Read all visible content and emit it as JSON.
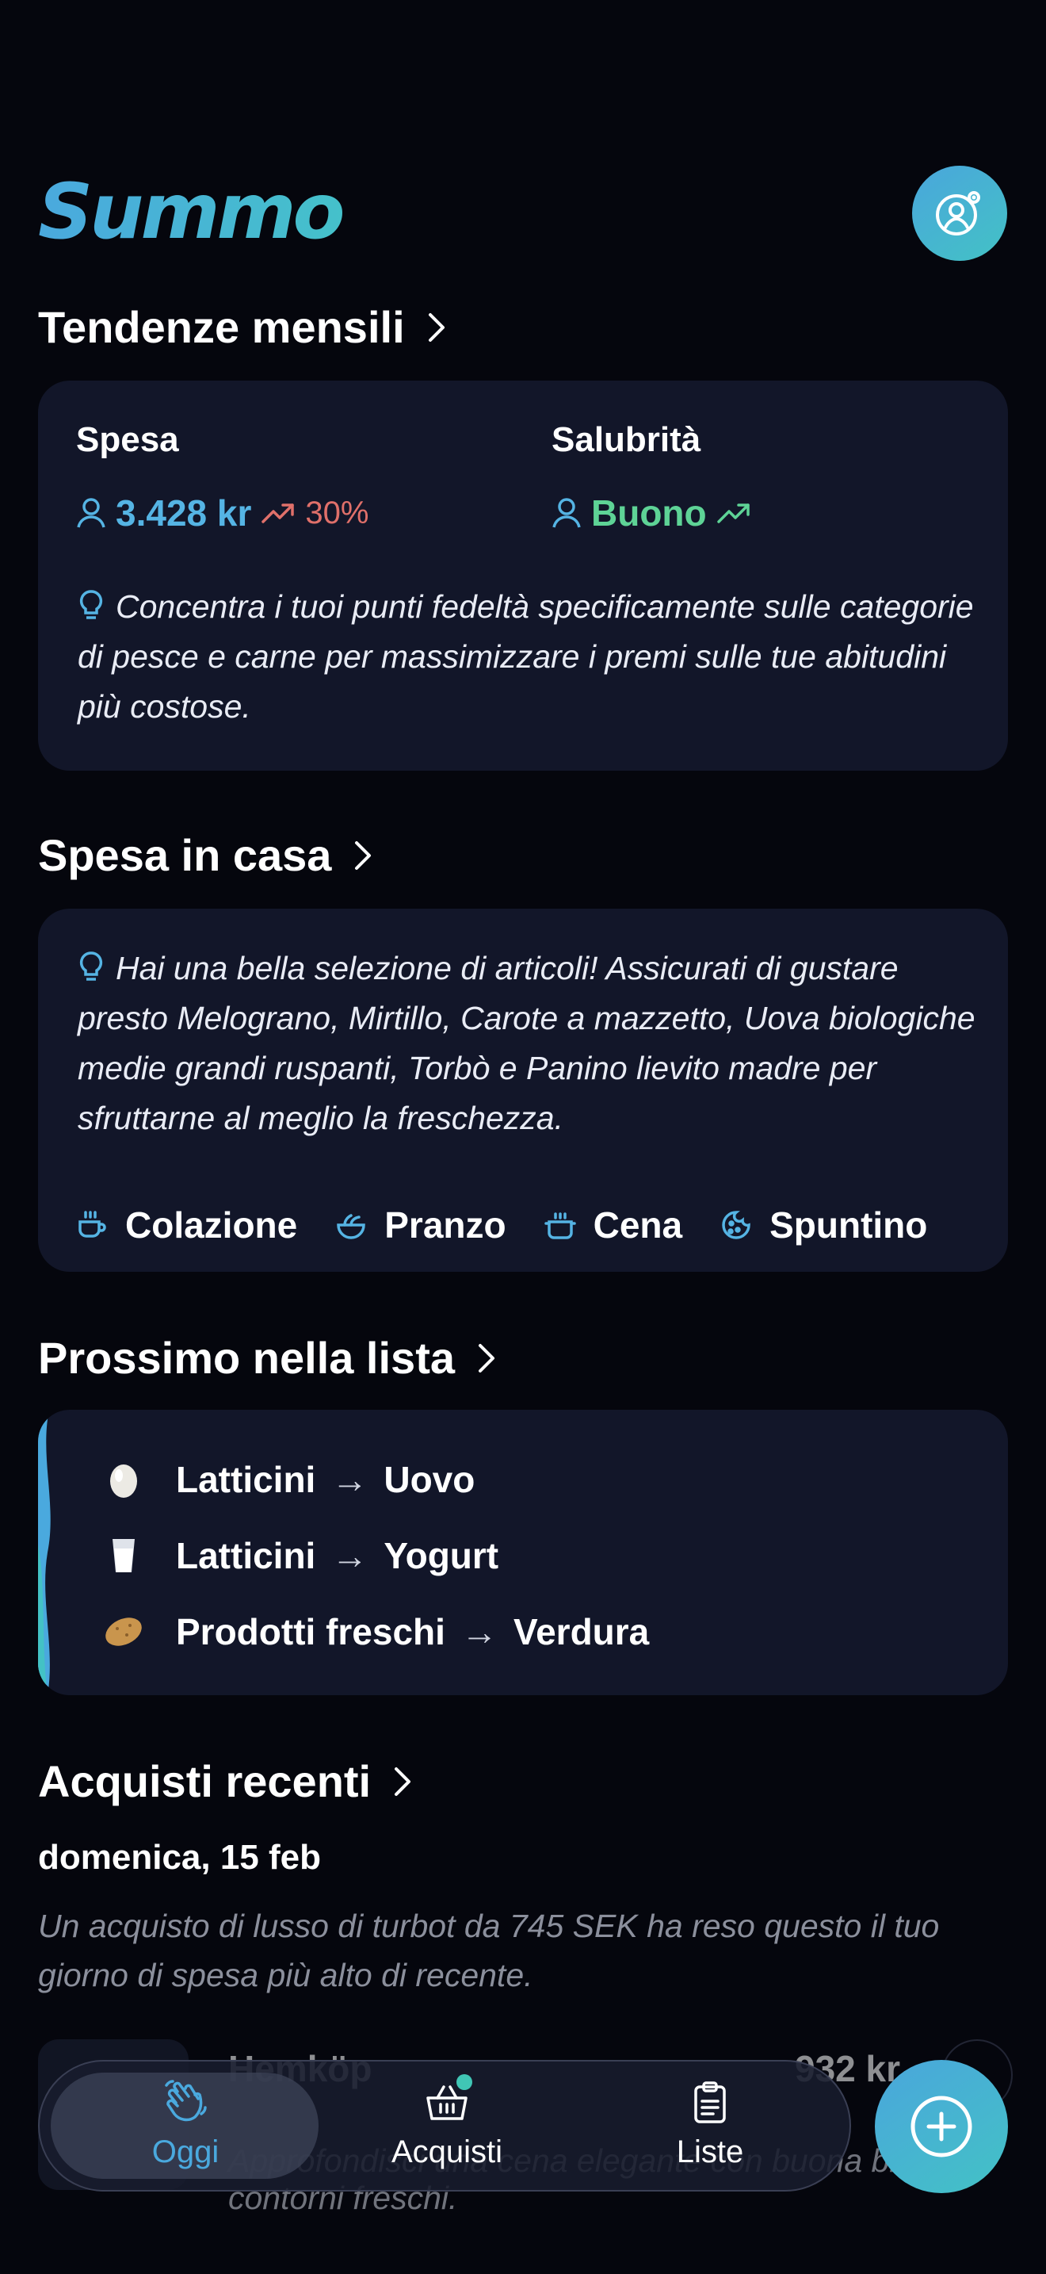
{
  "app": {
    "logo": "Summo",
    "logo_plus": "+"
  },
  "colors": {
    "accent_blue": "#4aa9de",
    "accent_teal": "#43c2c5",
    "card_bg": "#121629",
    "bg": "#05060d",
    "negative": "#e0706a",
    "positive": "#5ed396"
  },
  "trends": {
    "title": "Tendenze mensili",
    "spend_label": "Spesa",
    "spend_value": "3.428 kr",
    "spend_change": "30%",
    "health_label": "Salubrità",
    "health_value": "Buono",
    "tip": "Concentra i tuoi punti fedeltà specificamente sulle categorie di pesce e carne per massimizzare i premi sulle tue abitudini più costose."
  },
  "pantry": {
    "title": "Spesa in casa",
    "tip": "Hai una bella selezione di articoli! Assicurati di gustare presto Melograno, Mirtillo, Carote a mazzetto, Uova biologiche medie grandi ruspanti, Torbò e Panino lievito madre per sfruttarne al meglio la freschezza.",
    "meals": [
      {
        "label": "Colazione",
        "icon": "coffee-cup-icon"
      },
      {
        "label": "Pranzo",
        "icon": "salad-bowl-icon"
      },
      {
        "label": "Cena",
        "icon": "cooking-pot-icon"
      },
      {
        "label": "Spuntino",
        "icon": "cookie-icon"
      }
    ]
  },
  "next_list": {
    "title": "Prossimo nella lista",
    "items": [
      {
        "category": "Latticini",
        "item": "Uovo",
        "icon": "egg-icon"
      },
      {
        "category": "Latticini",
        "item": "Yogurt",
        "icon": "glass-of-milk-icon"
      },
      {
        "category": "Prodotti freschi",
        "item": "Verdura",
        "icon": "potato-icon"
      }
    ]
  },
  "recent": {
    "title": "Acquisti recenti",
    "date": "domenica,  15 feb",
    "summary": "Un acquisto di lusso di turbot da 745 SEK ha reso questo il tuo giorno di spesa più alto di recente.",
    "peek_title": "Hemköp",
    "peek_price": "932 kr",
    "peek_desc": "Approfondisci una cena elegante con buona birra e contorni freschi."
  },
  "nav": {
    "items": [
      {
        "label": "Oggi",
        "icon": "waving-hand-icon",
        "active": true
      },
      {
        "label": "Acquisti",
        "icon": "shopping-basket-icon",
        "active": false
      },
      {
        "label": "Liste",
        "icon": "clipboard-list-icon",
        "active": false
      }
    ]
  }
}
